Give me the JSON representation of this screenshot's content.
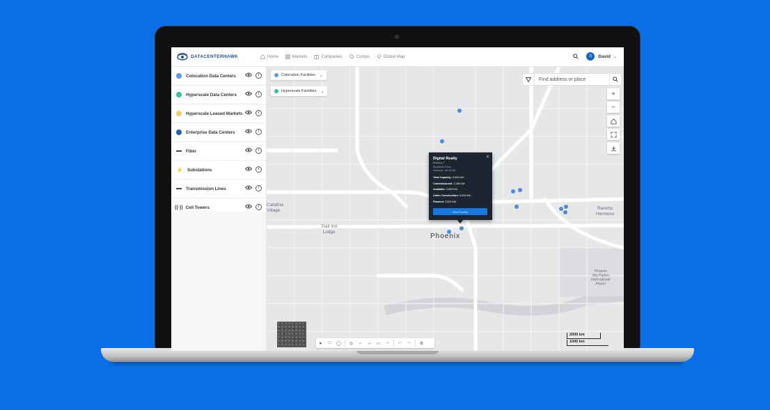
{
  "colors": {
    "background": "#0a6fe6",
    "brand": "#1e4f8f",
    "accent": "#1478e0",
    "colocation": "#5b9be6",
    "hyperscale": "#2fc4a1",
    "hyperscale_leased": "#f3c77a",
    "enterprise": "#1c5fb4",
    "popup_bg": "#1d2530"
  },
  "nav": {
    "logo_text": "DATACENTERHAWK",
    "items": [
      {
        "label": "Home",
        "icon": "home-icon"
      },
      {
        "label": "Markets",
        "icon": "grid-icon"
      },
      {
        "label": "Companies",
        "icon": "building-icon"
      },
      {
        "label": "Comps",
        "icon": "tag-icon"
      },
      {
        "label": "Global Map",
        "icon": "map-pin-icon"
      }
    ],
    "avatar_initials": "D",
    "user_name": "David"
  },
  "sidebar": {
    "layers": [
      {
        "label": "Colocation Data Centers"
      },
      {
        "label": "Hyperscale Data Centers"
      },
      {
        "label": "Hyperscale Leased Markets"
      },
      {
        "label": "Enterprise Data Centers"
      },
      {
        "label": "Fiber"
      },
      {
        "label": "Substations"
      },
      {
        "label": "Transmission Lines"
      },
      {
        "label": "Cell Towers"
      }
    ]
  },
  "map": {
    "filters": [
      {
        "label": "Colocation Facilities"
      },
      {
        "label": "Hyperscale Facilities"
      }
    ],
    "search_placeholder": "Find address or place",
    "places": {
      "catalina": "Catalina\nVillage",
      "trail_inn": "Trail Inn\nLodge",
      "phoenix": "Phoenix",
      "rancho": "Rancho\nHermoso",
      "airport": "Phoenix\nSky Harbor\nInternational\nAirport"
    },
    "scale": {
      "top": "2000 km",
      "bottom": "1000 km"
    }
  },
  "popup": {
    "title": "Digital Realty",
    "building": "Building T",
    "address_line1": "Broderick Drive",
    "address_line2": "Ashburn, VA 20146",
    "total_capacity_label": "Total Capacity:",
    "total_capacity": "3,000 kW",
    "commissioned_label": "Commissioned:",
    "commissioned": "2,450 kW",
    "available_label": "Available:",
    "available": "2,000 kW",
    "under_construction_label": "Under Construction:",
    "under_construction": "3,000 kW",
    "planned_label": "Planned:",
    "planned": "3,000 kW",
    "button": "View Facility"
  }
}
